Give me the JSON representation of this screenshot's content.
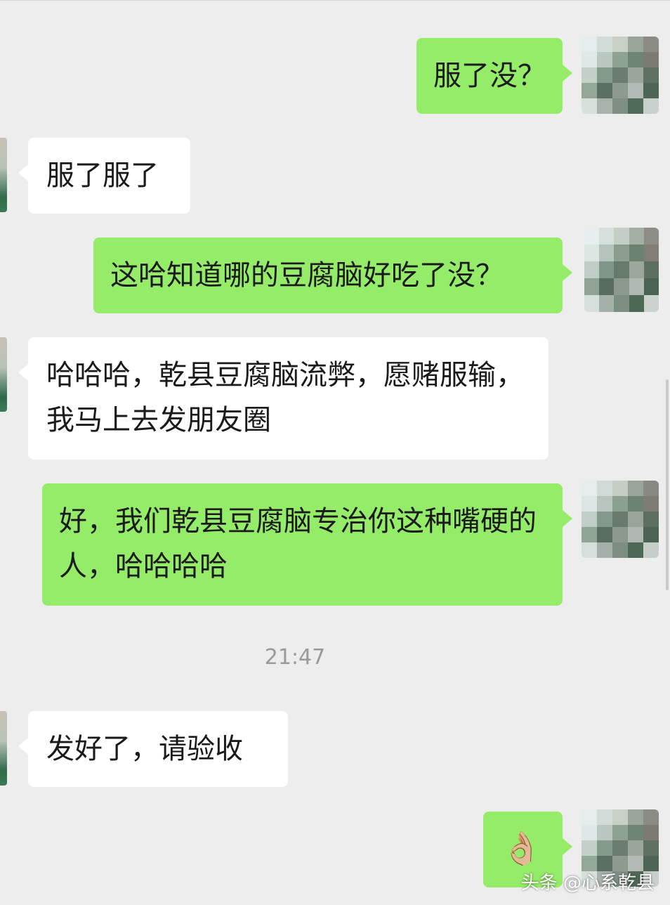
{
  "messages": [
    {
      "side": "right",
      "text": "服了没？"
    },
    {
      "side": "left",
      "text": "服了服了"
    },
    {
      "side": "right",
      "text": "这哈知道哪的豆腐脑好吃了没？"
    },
    {
      "side": "left",
      "text": "哈哈哈，乾县豆腐脑流弊，愿赌服输，我马上去发朋友圈"
    },
    {
      "side": "right",
      "text": "好，我们乾县豆腐脑专治你这种嘴硬的人，哈哈哈哈"
    },
    {
      "side": "left",
      "text": "发好了，请验收"
    },
    {
      "side": "right",
      "text": "👌🏼",
      "icon": "ok-hand-emoji"
    }
  ],
  "timestamp": "21:47",
  "watermark": "头条 @心系乾县",
  "colors": {
    "background": "#ededed",
    "sent_bubble": "#95ec69",
    "received_bubble": "#ffffff",
    "timestamp": "#9a9a9a"
  }
}
